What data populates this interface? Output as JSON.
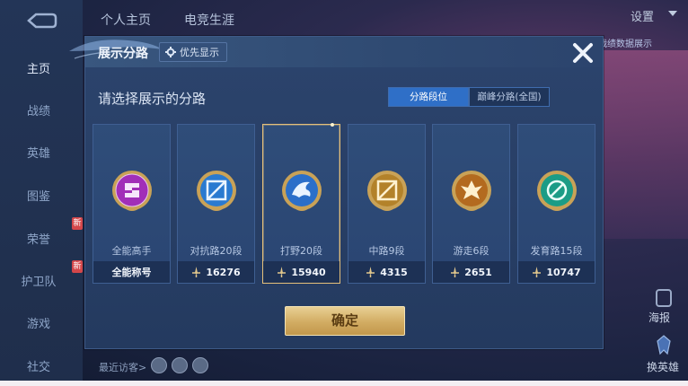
{
  "background": {
    "nav": [
      {
        "label": "主页",
        "active": true
      },
      {
        "label": "战绩"
      },
      {
        "label": "英雄"
      },
      {
        "label": "图鉴"
      },
      {
        "label": "荣誉",
        "badge": "新"
      },
      {
        "label": "护卫队",
        "badge": "新"
      },
      {
        "label": "游戏"
      },
      {
        "label": "社交"
      }
    ],
    "tabs": [
      "个人主页",
      "电竞生涯"
    ],
    "settings": "设置",
    "data_display": "战绩数据展示",
    "report": "海报",
    "change_hero": "换英雄",
    "recent_visitors": "最近访客>"
  },
  "dialog": {
    "title": "展示分路",
    "priority_label": "优先显示",
    "subtitle": "请选择展示的分路",
    "segments": [
      "分路段位",
      "巅峰分路(全国)"
    ],
    "confirm": "确定",
    "cards": [
      {
        "name": "全能高手",
        "value": "全能称号",
        "badge": "all-round-icon",
        "color": "#a12fb8",
        "sword": false
      },
      {
        "name": "对抗路20段",
        "value": "16276",
        "badge": "clash-lane-icon",
        "color": "#2a7ad0",
        "sword": true
      },
      {
        "name": "打野20段",
        "value": "15940",
        "badge": "jungle-icon",
        "color": "#2b6fc9",
        "sword": true,
        "selected": true
      },
      {
        "name": "中路9段",
        "value": "4315",
        "badge": "mid-lane-icon",
        "color": "#b3822a",
        "sword": true
      },
      {
        "name": "游走6段",
        "value": "2651",
        "badge": "roam-icon",
        "color": "#b36a1f",
        "sword": true
      },
      {
        "name": "发育路15段",
        "value": "10747",
        "badge": "farm-lane-icon",
        "color": "#1b9c86",
        "sword": true
      }
    ]
  }
}
